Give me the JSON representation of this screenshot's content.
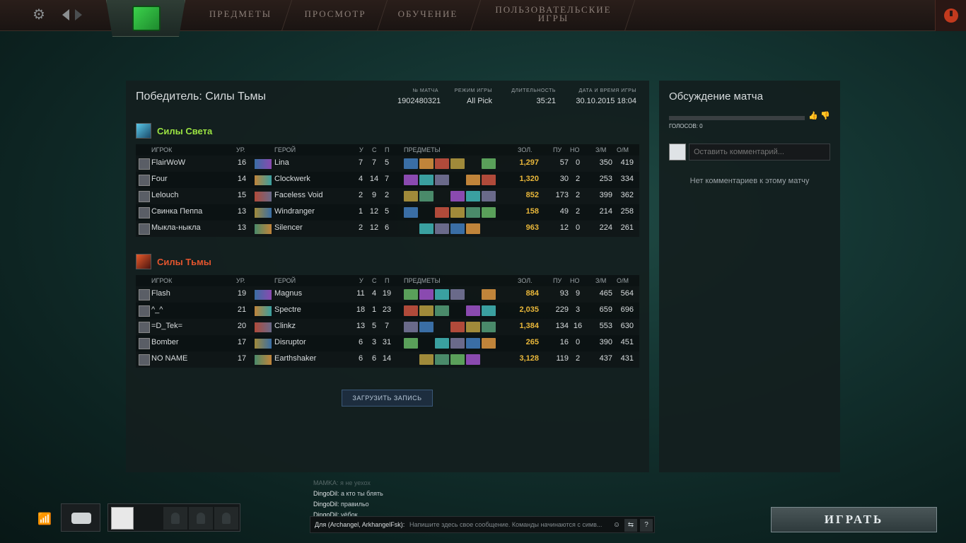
{
  "nav": {
    "tabs": [
      {
        "label": "ПРЕДМЕТЫ"
      },
      {
        "label": "ПРОСМОТР"
      },
      {
        "label": "ОБУЧЕНИЕ"
      },
      {
        "label_line1": "ПОЛЬЗОВАТЕЛЬСКИЕ",
        "label_line2": "ИГРЫ"
      }
    ]
  },
  "match": {
    "winner": "Победитель: Силы Тьмы",
    "id_label": "№ МАТЧА",
    "id": "1902480321",
    "mode_label": "РЕЖИМ ИГРЫ",
    "mode": "All Pick",
    "duration_label": "ДЛИТЕЛЬНОСТЬ",
    "duration": "35:21",
    "date_label": "ДАТА И ВРЕМЯ ИГРЫ",
    "date": "30.10.2015 18:04",
    "download_label": "ЗАГРУЗИТЬ ЗАПИСЬ"
  },
  "headers": {
    "player": "ИГРОК",
    "level": "УР.",
    "hero": "ГЕРОЙ",
    "k": "У",
    "d": "С",
    "a": "П",
    "items": "ПРЕДМЕТЫ",
    "gold": "ЗОЛ.",
    "lh": "ПУ",
    "dn": "НО",
    "gpm": "З/М",
    "xpm": "О/М"
  },
  "radiant": {
    "name": "Силы Света",
    "color": "#9be342",
    "players": [
      {
        "name": "FlairWoW",
        "level": "16",
        "hero": "Lina",
        "k": "7",
        "d": "7",
        "a": "5",
        "gold": "1,297",
        "lh": "57",
        "dn": "0",
        "gpm": "350",
        "xpm": "419"
      },
      {
        "name": "Four",
        "level": "14",
        "hero": "Clockwerk",
        "k": "4",
        "d": "14",
        "a": "7",
        "gold": "1,320",
        "lh": "30",
        "dn": "2",
        "gpm": "253",
        "xpm": "334"
      },
      {
        "name": "Lelouch",
        "level": "15",
        "hero": "Faceless Void",
        "k": "2",
        "d": "9",
        "a": "2",
        "gold": "852",
        "lh": "173",
        "dn": "2",
        "gpm": "399",
        "xpm": "362"
      },
      {
        "name": "Свинка Пеппа",
        "level": "13",
        "hero": "Windranger",
        "k": "1",
        "d": "12",
        "a": "5",
        "gold": "158",
        "lh": "49",
        "dn": "2",
        "gpm": "214",
        "xpm": "258"
      },
      {
        "name": "Мыкла-ныкла",
        "level": "13",
        "hero": "Silencer",
        "k": "2",
        "d": "12",
        "a": "6",
        "gold": "963",
        "lh": "12",
        "dn": "0",
        "gpm": "224",
        "xpm": "261"
      }
    ]
  },
  "dire": {
    "name": "Силы Тьмы",
    "color": "#e3552e",
    "players": [
      {
        "name": "Flash",
        "level": "19",
        "hero": "Magnus",
        "k": "11",
        "d": "4",
        "a": "19",
        "gold": "884",
        "lh": "93",
        "dn": "9",
        "gpm": "465",
        "xpm": "564"
      },
      {
        "name": "^_^",
        "level": "21",
        "hero": "Spectre",
        "k": "18",
        "d": "1",
        "a": "23",
        "gold": "2,035",
        "lh": "229",
        "dn": "3",
        "gpm": "659",
        "xpm": "696"
      },
      {
        "name": "=D_Tek=",
        "level": "20",
        "hero": "Clinkz",
        "k": "13",
        "d": "5",
        "a": "7",
        "gold": "1,384",
        "lh": "134",
        "dn": "16",
        "gpm": "553",
        "xpm": "630"
      },
      {
        "name": "Bomber",
        "level": "17",
        "hero": "Disruptor",
        "k": "6",
        "d": "3",
        "a": "31",
        "gold": "265",
        "lh": "16",
        "dn": "0",
        "gpm": "390",
        "xpm": "451"
      },
      {
        "name": "NO NAME",
        "level": "17",
        "hero": "Earthshaker",
        "k": "6",
        "d": "6",
        "a": "14",
        "gold": "3,128",
        "lh": "119",
        "dn": "2",
        "gpm": "437",
        "xpm": "431"
      }
    ]
  },
  "discussion": {
    "title": "Обсуждение матча",
    "votes": "ГОЛОСОВ: 0",
    "placeholder": "Оставить комментарий...",
    "empty": "Нет комментариев к этому матчу"
  },
  "chat": {
    "lines": [
      {
        "who": "MAMKA",
        "text": ": я не уехох",
        "faded": true
      },
      {
        "who": "DingoDil",
        "text": ": а кто ты блять"
      },
      {
        "who": "DingoDil",
        "text": ": правильо"
      },
      {
        "who": "DingoDil",
        "text": ": уёбок"
      }
    ],
    "target": "Для (Archangel, ArkhangelFsk):",
    "placeholder": "Напишите здесь свое сообщение. Команды начинаются с симв...",
    "help": "?"
  },
  "play_label": "ИГРАТЬ"
}
